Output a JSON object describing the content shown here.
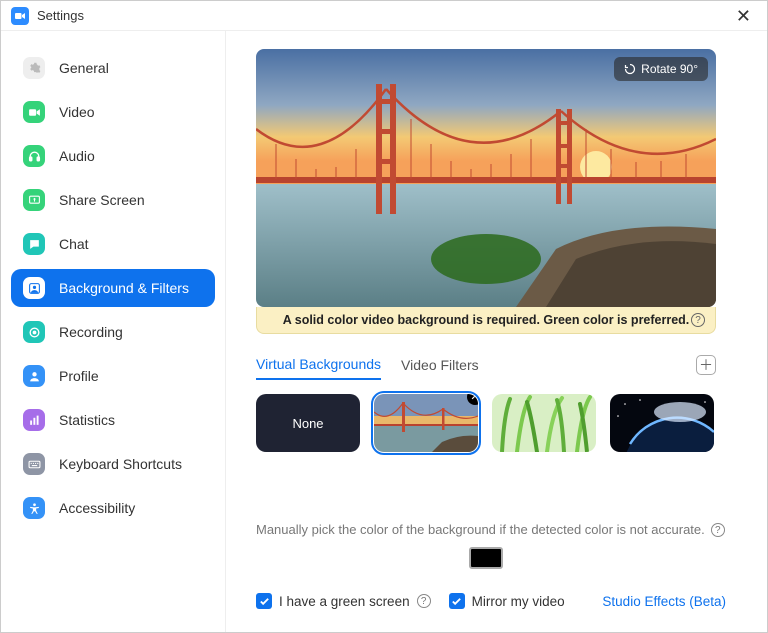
{
  "window": {
    "title": "Settings"
  },
  "sidebar": {
    "items": [
      {
        "label": "General"
      },
      {
        "label": "Video"
      },
      {
        "label": "Audio"
      },
      {
        "label": "Share Screen"
      },
      {
        "label": "Chat"
      },
      {
        "label": "Background & Filters"
      },
      {
        "label": "Recording"
      },
      {
        "label": "Profile"
      },
      {
        "label": "Statistics"
      },
      {
        "label": "Keyboard Shortcuts"
      },
      {
        "label": "Accessibility"
      }
    ]
  },
  "preview": {
    "rotate_label": "Rotate 90°",
    "notice": "A solid color video background is required. Green color is preferred."
  },
  "tabs": {
    "virtual_backgrounds": "Virtual Backgrounds",
    "video_filters": "Video Filters"
  },
  "thumbs": {
    "none_label": "None"
  },
  "hint": "Manually pick the color of the background if the detected color is not accurate.",
  "checkboxes": {
    "green_screen": "I have a green screen",
    "mirror": "Mirror my video"
  },
  "link": "Studio Effects (Beta)"
}
